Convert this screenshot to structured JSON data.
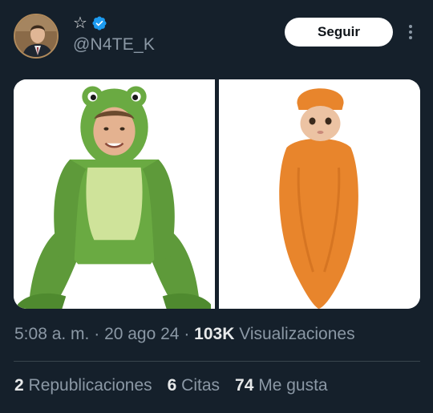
{
  "author": {
    "avatar_icon": "profile-photo-man-in-suit",
    "name_icon": "star-outline-icon",
    "verified": true,
    "handle": "@N4TE_K"
  },
  "actions": {
    "follow_label": "Seguir",
    "more_icon": "more-vertical-icon"
  },
  "media": [
    {
      "description_icon": "photo-frog-costume"
    },
    {
      "description_icon": "photo-carrot-costume"
    }
  ],
  "meta": {
    "time": "5:08 a. m.",
    "sep1": "·",
    "date": "20 ago 24",
    "sep2": "·",
    "views_count": "103K",
    "views_label": "Visualizaciones"
  },
  "stats": {
    "reposts_count": "2",
    "reposts_label": "Republicaciones",
    "quotes_count": "6",
    "quotes_label": "Citas",
    "likes_count": "74",
    "likes_label": "Me gusta"
  },
  "colors": {
    "background": "#15202b",
    "verified": "#1d9bf0",
    "muted_text": "#8b98a5",
    "primary_text": "#e7e9ea"
  }
}
